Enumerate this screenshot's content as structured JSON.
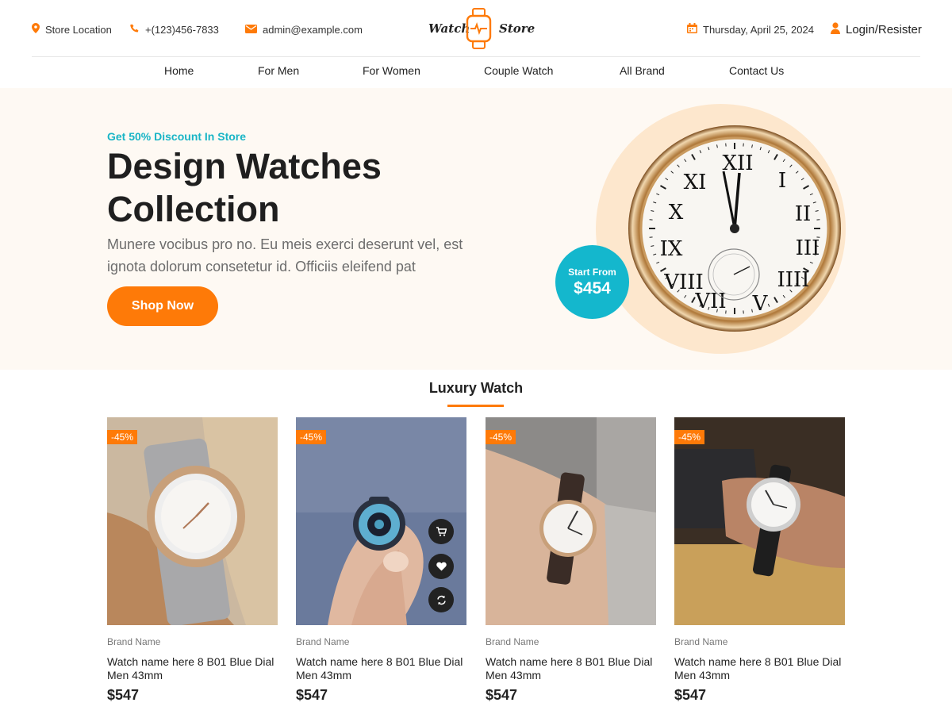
{
  "topbar": {
    "store_location": "Store Location",
    "phone": "+(123)456-7833",
    "email": "admin@example.com",
    "logo_left": "Watch",
    "logo_right": "Store",
    "date": "Thursday, April 25, 2024",
    "login": "Login/Resister"
  },
  "nav": {
    "items": [
      {
        "label": "Home"
      },
      {
        "label": "For Men"
      },
      {
        "label": "For Women"
      },
      {
        "label": "Couple Watch"
      },
      {
        "label": "All Brand"
      },
      {
        "label": "Contact Us"
      }
    ]
  },
  "hero": {
    "promo": "Get 50% Discount In Store",
    "title_line1": "Design Watches",
    "title_line2": "Collection",
    "description": "Munere vocibus pro no. Eu meis exerci deserunt vel, est ignota dolorum consetetur id. Officiis eleifend pat",
    "cta": "Shop Now",
    "badge_label": "Start From",
    "badge_price": "$454"
  },
  "section": {
    "title": "Luxury Watch"
  },
  "products": [
    {
      "discount": "-45%",
      "brand": "Brand Name",
      "name": "Watch name here 8 B01 Blue Dial Men 43mm",
      "price": "$547"
    },
    {
      "discount": "-45%",
      "brand": "Brand Name",
      "name": "Watch name here 8 B01 Blue Dial Men 43mm",
      "price": "$547"
    },
    {
      "discount": "-45%",
      "brand": "Brand Name",
      "name": "Watch name here 8 B01 Blue Dial Men 43mm",
      "price": "$547"
    },
    {
      "discount": "-45%",
      "brand": "Brand Name",
      "name": "Watch name here 8 B01 Blue Dial Men 43mm",
      "price": "$547"
    }
  ],
  "icons": {
    "location": "map-pin-icon",
    "phone": "phone-icon",
    "email": "mail-icon",
    "date": "calendar-icon",
    "user": "user-icon",
    "cart": "cart-icon",
    "wishlist": "heart-icon",
    "compare": "refresh-icon"
  },
  "colors": {
    "accent": "#fe7a08",
    "secondary": "#14b7cd",
    "hero_bg": "#fef9f3"
  }
}
